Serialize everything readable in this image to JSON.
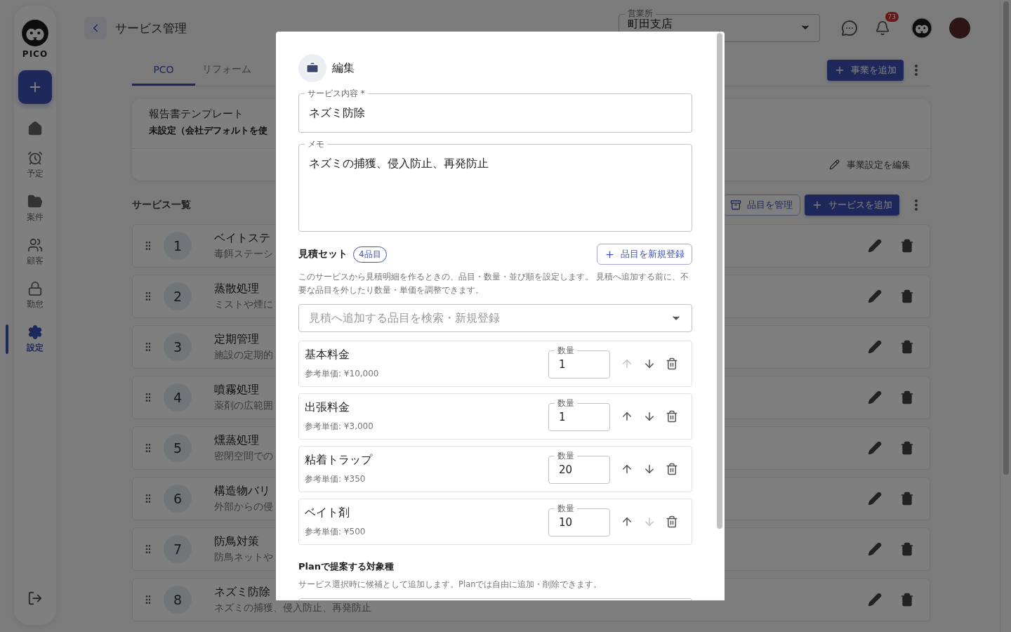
{
  "sidebar": {
    "logo_text": "PICO",
    "items": [
      {
        "selected": false
      },
      {
        "label": "予定",
        "selected": false
      },
      {
        "label": "案件",
        "selected": false
      },
      {
        "label": "顧客",
        "selected": false
      },
      {
        "label": "勤怠",
        "selected": false
      },
      {
        "label": "設定",
        "selected": true
      }
    ]
  },
  "header": {
    "title": "サービス管理",
    "office": {
      "label": "営業所",
      "value": "町田支店"
    },
    "notification_count": "73"
  },
  "tabs": [
    {
      "label": "PCO",
      "selected": true
    },
    {
      "label": "リフォーム",
      "selected": false
    }
  ],
  "add_business_button": "事業を追加",
  "template_card": {
    "title": "報告書テンプレート",
    "value": "未設定（会社デフォルトを使",
    "edit_link": "事業設定を編集"
  },
  "services": {
    "title": "サービス一覧",
    "manage_button": "品目を管理",
    "add_button": "サービスを追加",
    "rows": [
      {
        "number": "1",
        "name": "ベイトステ",
        "description": "毒餌ステーシ"
      },
      {
        "number": "2",
        "name": "蒸散処理",
        "description": "ミストや煙に"
      },
      {
        "number": "3",
        "name": "定期管理",
        "description": "施設の定期的"
      },
      {
        "number": "4",
        "name": "噴霧処理",
        "description": "薬剤の広範囲"
      },
      {
        "number": "5",
        "name": "燻蒸処理",
        "description": "密閉空間での"
      },
      {
        "number": "6",
        "name": "構造物バリ",
        "description": "外部からの侵"
      },
      {
        "number": "7",
        "name": "防鳥対策",
        "description": "防鳥ネットや"
      },
      {
        "number": "8",
        "name": "ネズミ防除",
        "description": "ネズミの捕獲、侵入防止、再発防止"
      }
    ]
  },
  "dialog": {
    "title": "編集",
    "service_field": {
      "label": "サービス内容",
      "required_mark": "*",
      "value": "ネズミ防除"
    },
    "memo_field": {
      "label": "メモ",
      "value": "ネズミの捕獲、侵入防止、再発防止"
    },
    "estimate": {
      "title": "見積セット",
      "count_chip": "4品目",
      "register_button": "品目を新規登録",
      "description": "このサービスから見積明細を作るときの、品目・数量・並び順を設定します。 見積へ追加する前に、不要な品目を外したり数量・単価を調整できます。",
      "search_placeholder": "見積へ追加する品目を検索・新規登録",
      "items": [
        {
          "name": "基本料金",
          "price": "参考単価: ¥10,000",
          "quantity_label": "数量",
          "quantity": "1",
          "up_disabled": true,
          "down_disabled": false
        },
        {
          "name": "出張料金",
          "price": "参考単価: ¥3,000",
          "quantity_label": "数量",
          "quantity": "1",
          "up_disabled": false,
          "down_disabled": false
        },
        {
          "name": "粘着トラップ",
          "price": "参考単価: ¥350",
          "quantity_label": "数量",
          "quantity": "20",
          "up_disabled": false,
          "down_disabled": false
        },
        {
          "name": "ベイト剤",
          "price": "参考単価: ¥500",
          "quantity_label": "数量",
          "quantity": "10",
          "up_disabled": false,
          "down_disabled": true
        }
      ]
    },
    "plan": {
      "title": "Planで提案する対象種",
      "description": "サービス選択時に候補として追加します。Planでは自由に追加・削除できます。"
    }
  }
}
